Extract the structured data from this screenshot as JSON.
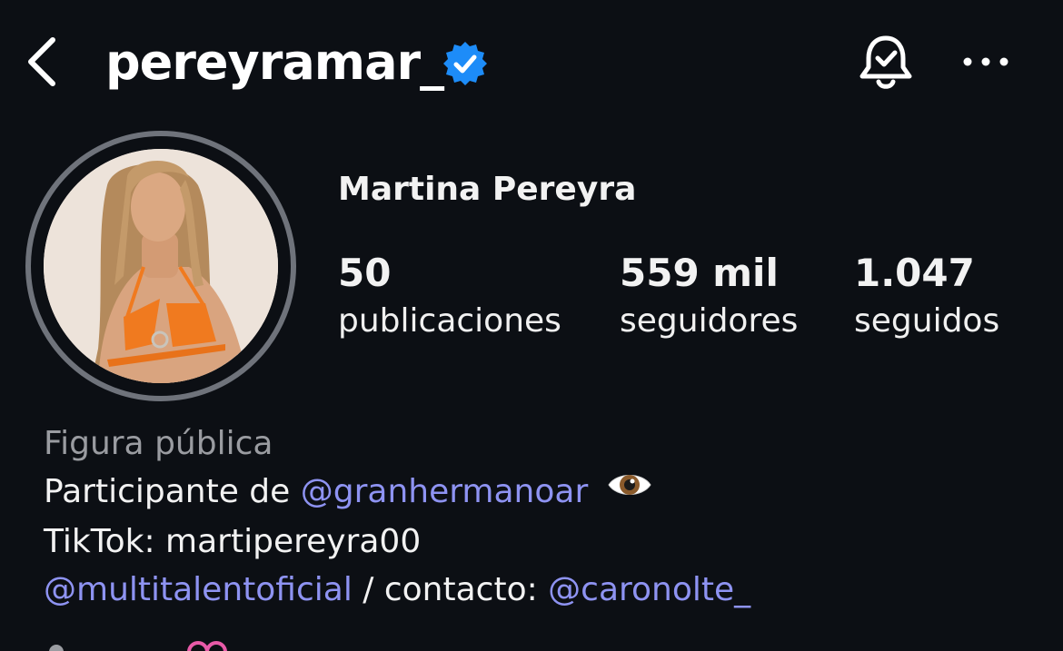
{
  "header": {
    "username": "pereyramar_",
    "icons": {
      "back": "chevron-left-icon",
      "verified": "verified-badge-icon",
      "notifications": "bell-check-icon",
      "more": "more-horizontal-icon"
    }
  },
  "profile": {
    "full_name": "Martina Pereyra",
    "avatar": "profile-photo",
    "stats": [
      {
        "value": "50",
        "label": "publicaciones"
      },
      {
        "value": "559 mil",
        "label": "seguidores"
      },
      {
        "value": "1.047",
        "label": "seguidos"
      }
    ]
  },
  "bio": {
    "category": "Figura pública",
    "line1_text": "Participante de ",
    "line1_mention": "@granhermanoar",
    "line1_emoji": "eye-emoji",
    "line2": "TikTok: martipereyra00",
    "line3_mention1": "@multitalentoficial",
    "line3_text": " / contacto: ",
    "line3_mention2": "@caronolte_"
  },
  "colors": {
    "background": "#0c0f14",
    "text": "#f2f2f2",
    "secondary_text": "#9a9ca1",
    "link": "#8e93f2",
    "verified_blue": "#1d8cf8",
    "avatar_ring": "#6f737b"
  }
}
